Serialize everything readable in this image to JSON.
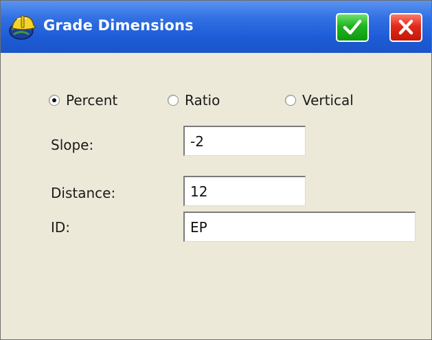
{
  "window": {
    "title": "Grade Dimensions",
    "app_icon": "hardhat-globe-icon",
    "ok_icon": "checkmark-icon",
    "cancel_icon": "close-icon",
    "colors": {
      "titlebar": "#1d5cd6",
      "ok": "#1fb41f",
      "cancel": "#e02a18",
      "body": "#ece9d8"
    }
  },
  "mode": {
    "selected": "Percent",
    "options": [
      {
        "label": "Percent",
        "checked": true
      },
      {
        "label": "Ratio",
        "checked": false
      },
      {
        "label": "Vertical",
        "checked": false
      }
    ]
  },
  "fields": {
    "slope": {
      "label": "Slope:",
      "value": "-2"
    },
    "distance": {
      "label": "Distance:",
      "value": "12"
    },
    "id": {
      "label": "ID:",
      "value": "EP"
    }
  }
}
